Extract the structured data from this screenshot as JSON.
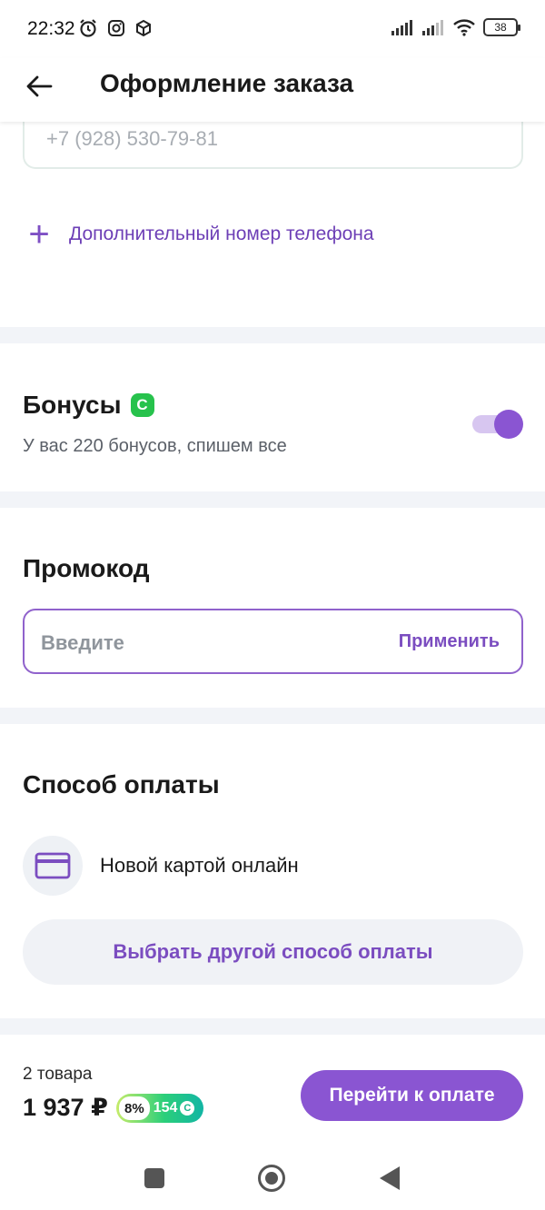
{
  "status_bar": {
    "time": "22:32",
    "battery": "38",
    "icons_left": [
      "alarm-icon",
      "instagram-icon",
      "box-icon"
    ],
    "icons_right": [
      "signal-icon",
      "signal-icon",
      "wifi-icon",
      "battery-icon"
    ]
  },
  "header": {
    "title": "Оформление заказа",
    "back_icon": "arrow-left-icon"
  },
  "contact": {
    "phone_placeholder": "+7 (928) 530-79-81",
    "add_phone_label": "Дополнительный номер телефона"
  },
  "bonuses": {
    "title": "Бонусы",
    "subtitle": "У вас 220 бонусов, спишем все",
    "toggle_on": true,
    "coin_symbol": "C",
    "accent": "#27c24c"
  },
  "promo": {
    "title": "Промокод",
    "placeholder": "Введите",
    "apply_label": "Применить"
  },
  "payment": {
    "title": "Способ оплаты",
    "method_label": "Новой картой онлайн",
    "method_icon": "credit-card-icon",
    "other_button": "Выбрать другой способ оплаты"
  },
  "footer": {
    "items_count": "2 товара",
    "total": "1 937 ₽",
    "cashback_percent": "8%",
    "cashback_points": "154",
    "checkout_button": "Перейти к оплате",
    "accent": "#8a55d2"
  },
  "navbar": {
    "icons": [
      "recents-icon",
      "home-icon",
      "back-icon"
    ]
  }
}
